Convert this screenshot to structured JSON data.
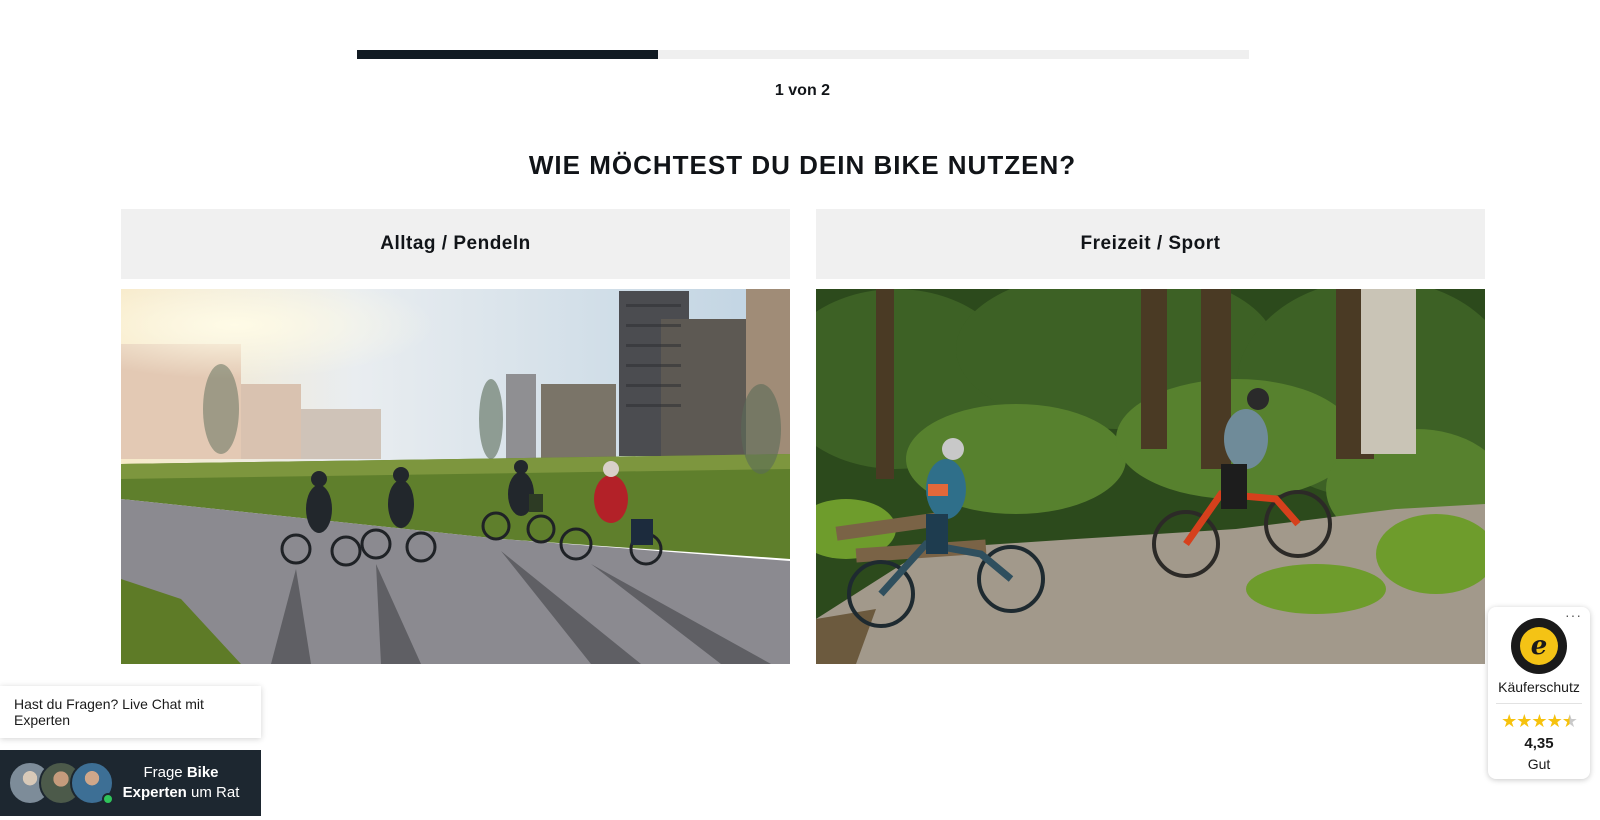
{
  "progress": {
    "text": "1 von 2",
    "fraction": 0.338
  },
  "question": {
    "title": "WIE MÖCHTEST DU DEIN BIKE NUTZEN?"
  },
  "options": [
    {
      "label": "Alltag / Pendeln",
      "image": "city-commute-cyclists-photo"
    },
    {
      "label": "Freizeit / Sport",
      "image": "forest-mountain-bike-photo"
    }
  ],
  "chat": {
    "bubble_text": "Hast du Fragen? Live Chat mit Experten",
    "button_line1_prefix": "Frage ",
    "button_line1_bold": "Bike",
    "button_line2_bold": "Experten",
    "button_line2_suffix": " um Rat",
    "status_color": "#2fc45a"
  },
  "trust_badge": {
    "more_label": "···",
    "seal_letter": "e",
    "title": "Käuferschutz",
    "rating_value": 4.35,
    "score": "4,35",
    "rating_text": "Gut",
    "star_color": "#f6c20d"
  }
}
